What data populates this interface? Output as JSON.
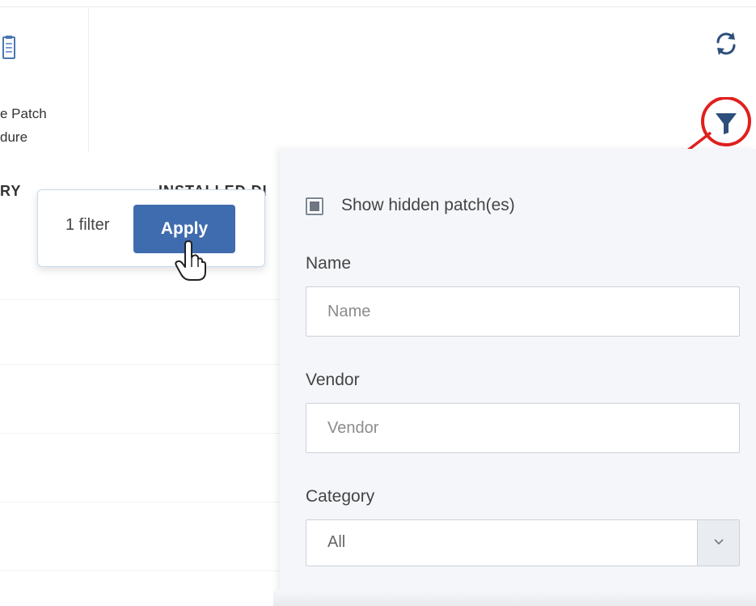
{
  "toolbar": {
    "patch_procedure_label": "e Patch\ndure",
    "icons": {
      "procedure": "clipboard-icon",
      "refresh": "refresh-icon",
      "filter": "filter-icon"
    }
  },
  "table": {
    "headers": {
      "category": "RY",
      "installed": "INSTALLED DI"
    }
  },
  "apply_popup": {
    "filter_count": "1 filter",
    "apply_label": "Apply"
  },
  "filter_panel": {
    "show_hidden_label": "Show hidden patch(es)",
    "show_hidden_checked": true,
    "name_label": "Name",
    "name_placeholder": "Name",
    "name_value": "",
    "vendor_label": "Vendor",
    "vendor_placeholder": "Vendor",
    "vendor_value": "",
    "category_label": "Category",
    "category_selected": "All"
  },
  "colors": {
    "accent": "#3f6cae",
    "annotation": "#e0201e",
    "filter_icon": "#2d4e7c",
    "panel_bg": "#f4f6fa"
  }
}
